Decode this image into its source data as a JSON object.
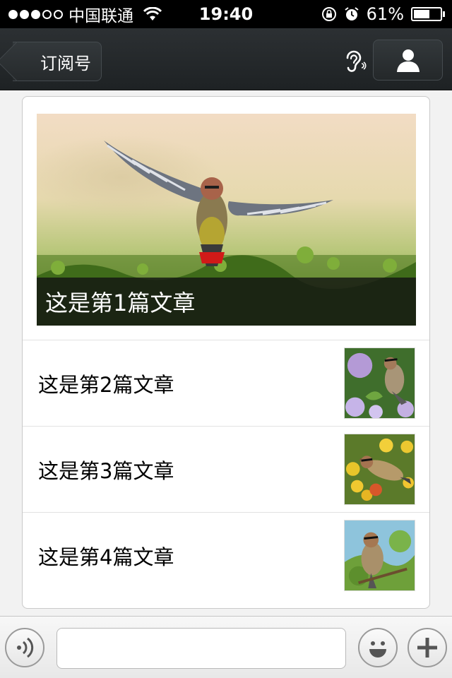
{
  "status_bar": {
    "carrier": "中国联通",
    "time": "19:40",
    "battery_percent_label": "61%",
    "battery_level": 0.61,
    "signal_bars_filled": 3,
    "signal_bars_total": 5
  },
  "nav": {
    "back_label": "订阅号",
    "back_icon": "chevron-left-icon",
    "ear_icon": "ear-icon",
    "profile_icon": "person-icon"
  },
  "articles": [
    {
      "title": "这是第1篇文章",
      "image": "bird-in-flight"
    },
    {
      "title": "这是第2篇文章",
      "image": "waxwing-on-flowers"
    },
    {
      "title": "这是第3篇文章",
      "image": "waxwing-with-fruit"
    },
    {
      "title": "这是第4篇文章",
      "image": "waxwing-on-branch"
    }
  ],
  "toolbar": {
    "voice_icon": "voice-icon",
    "input_placeholder": "",
    "emoji_icon": "smiley-icon",
    "plus_icon": "plus-icon"
  },
  "colors": {
    "nav_bg": "#25292b",
    "status_bg": "#000000",
    "card_bg": "#ffffff",
    "page_bg": "#f2f2f2"
  }
}
